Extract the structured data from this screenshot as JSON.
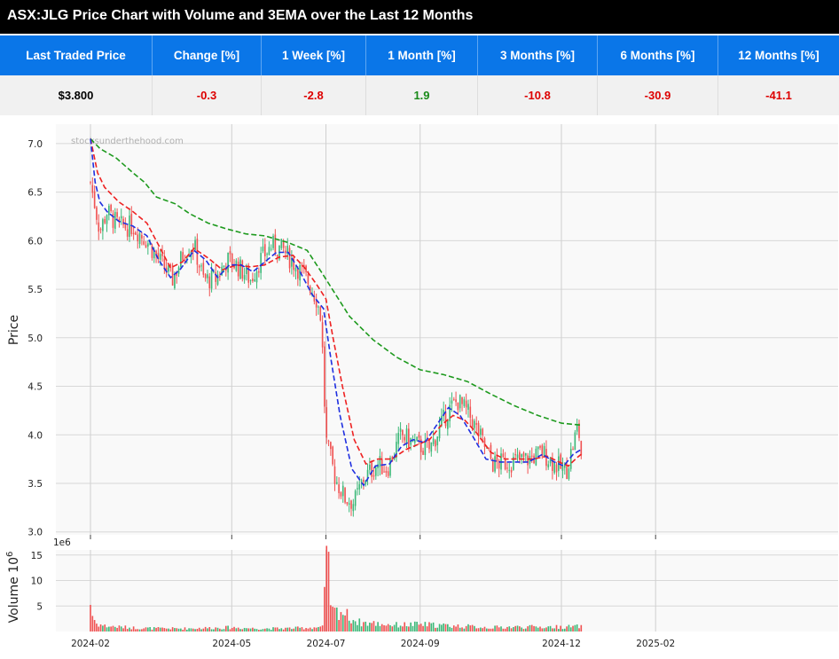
{
  "title": "ASX:JLG Price Chart with Volume and 3EMA over the Last 12 Months",
  "table": {
    "headers": [
      "Last Traded Price",
      "Change [%]",
      "1 Week [%]",
      "1 Month [%]",
      "3 Months [%]",
      "6 Months [%]",
      "12 Months [%]"
    ],
    "values": [
      {
        "text": "$3.800",
        "tone": "neutral"
      },
      {
        "text": "-0.3",
        "tone": "neg"
      },
      {
        "text": "-2.8",
        "tone": "neg"
      },
      {
        "text": "1.9",
        "tone": "pos"
      },
      {
        "text": "-10.8",
        "tone": "neg"
      },
      {
        "text": "-30.9",
        "tone": "neg"
      },
      {
        "text": "-41.1",
        "tone": "neg"
      }
    ]
  },
  "colors": {
    "header_bg": "#0a76e8",
    "up": "#3cb878",
    "down": "#f05252",
    "ema_short": "#1f2fe0",
    "ema_mid": "#ee2222",
    "ema_long": "#1e9a1e"
  },
  "chart_data": {
    "type": "candlestick",
    "watermark": "stocksunderthehood.com",
    "price_axis": {
      "label": "Price",
      "ylim": [
        2.97,
        7.2
      ],
      "ticks": [
        3.0,
        3.5,
        4.0,
        4.5,
        5.0,
        5.5,
        6.0,
        6.5,
        7.0
      ],
      "tick_labels": [
        "3.0",
        "3.5",
        "4.0",
        "4.5",
        "5.0",
        "5.5",
        "6.0",
        "6.5",
        "7.0"
      ]
    },
    "volume_axis": {
      "label": "Volume  10",
      "label_sup": "6",
      "offset_text": "1e6",
      "ylim": [
        0,
        16
      ],
      "ticks": [
        5,
        10,
        15
      ],
      "tick_labels": [
        "5",
        "10",
        "15"
      ]
    },
    "x_axis": {
      "tick_labels": [
        "2024-02",
        "2024-05",
        "2024-07",
        "2024-09",
        "2024-12",
        "2025-02"
      ],
      "tick_months": [
        0,
        3,
        5,
        7,
        10,
        12
      ]
    },
    "grid": true,
    "close_keypoints": [
      [
        0,
        6.6
      ],
      [
        0.12,
        6.3
      ],
      [
        0.2,
        6.1
      ],
      [
        0.35,
        6.3
      ],
      [
        0.6,
        6.15
      ],
      [
        0.9,
        6.15
      ],
      [
        1.2,
        6.0
      ],
      [
        1.45,
        5.8
      ],
      [
        1.75,
        5.6
      ],
      [
        2.0,
        5.9
      ],
      [
        2.2,
        5.95
      ],
      [
        2.4,
        5.6
      ],
      [
        2.65,
        5.6
      ],
      [
        2.9,
        5.8
      ],
      [
        3.1,
        5.75
      ],
      [
        3.4,
        5.6
      ],
      [
        3.6,
        5.8
      ],
      [
        3.85,
        5.95
      ],
      [
        4.1,
        5.9
      ],
      [
        4.35,
        5.75
      ],
      [
        4.6,
        5.6
      ],
      [
        4.8,
        5.4
      ],
      [
        4.9,
        5.2
      ],
      [
        5.0,
        3.95
      ],
      [
        5.2,
        3.55
      ],
      [
        5.4,
        3.35
      ],
      [
        5.6,
        3.3
      ],
      [
        5.8,
        3.55
      ],
      [
        6.1,
        3.7
      ],
      [
        6.3,
        3.65
      ],
      [
        6.6,
        4.0
      ],
      [
        6.9,
        3.9
      ],
      [
        7.2,
        3.85
      ],
      [
        7.6,
        4.25
      ],
      [
        7.8,
        4.35
      ],
      [
        8.05,
        4.2
      ],
      [
        8.3,
        3.95
      ],
      [
        8.55,
        3.7
      ],
      [
        8.9,
        3.72
      ],
      [
        9.3,
        3.75
      ],
      [
        9.6,
        3.82
      ],
      [
        9.85,
        3.7
      ],
      [
        10.1,
        3.62
      ],
      [
        10.25,
        3.9
      ],
      [
        10.35,
        4.1
      ],
      [
        10.4,
        3.9
      ],
      [
        10.42,
        3.8
      ]
    ],
    "ema_short_keypoints": [
      [
        0,
        7.05
      ],
      [
        0.1,
        6.6
      ],
      [
        0.2,
        6.4
      ],
      [
        0.35,
        6.3
      ],
      [
        0.6,
        6.2
      ],
      [
        0.9,
        6.15
      ],
      [
        1.2,
        6.05
      ],
      [
        1.45,
        5.8
      ],
      [
        1.7,
        5.62
      ],
      [
        1.9,
        5.7
      ],
      [
        2.2,
        5.9
      ],
      [
        2.45,
        5.8
      ],
      [
        2.7,
        5.62
      ],
      [
        2.95,
        5.75
      ],
      [
        3.2,
        5.75
      ],
      [
        3.45,
        5.68
      ],
      [
        3.7,
        5.78
      ],
      [
        3.95,
        5.88
      ],
      [
        4.2,
        5.88
      ],
      [
        4.45,
        5.68
      ],
      [
        4.7,
        5.45
      ],
      [
        4.95,
        5.3
      ],
      [
        5.1,
        4.8
      ],
      [
        5.3,
        4.2
      ],
      [
        5.55,
        3.65
      ],
      [
        5.8,
        3.48
      ],
      [
        6.05,
        3.68
      ],
      [
        6.35,
        3.7
      ],
      [
        6.6,
        3.88
      ],
      [
        6.85,
        3.95
      ],
      [
        7.1,
        3.92
      ],
      [
        7.35,
        4.1
      ],
      [
        7.6,
        4.28
      ],
      [
        7.85,
        4.2
      ],
      [
        8.1,
        4.0
      ],
      [
        8.4,
        3.75
      ],
      [
        8.7,
        3.72
      ],
      [
        9.0,
        3.72
      ],
      [
        9.3,
        3.72
      ],
      [
        9.6,
        3.8
      ],
      [
        9.85,
        3.72
      ],
      [
        10.05,
        3.68
      ],
      [
        10.25,
        3.8
      ],
      [
        10.42,
        3.85
      ]
    ],
    "ema_mid_keypoints": [
      [
        0,
        7.05
      ],
      [
        0.15,
        6.7
      ],
      [
        0.3,
        6.55
      ],
      [
        0.6,
        6.4
      ],
      [
        0.9,
        6.3
      ],
      [
        1.2,
        6.18
      ],
      [
        1.45,
        5.95
      ],
      [
        1.7,
        5.72
      ],
      [
        1.95,
        5.78
      ],
      [
        2.2,
        5.92
      ],
      [
        2.5,
        5.82
      ],
      [
        2.8,
        5.7
      ],
      [
        3.1,
        5.75
      ],
      [
        3.4,
        5.73
      ],
      [
        3.7,
        5.75
      ],
      [
        4.0,
        5.83
      ],
      [
        4.3,
        5.85
      ],
      [
        4.55,
        5.72
      ],
      [
        4.8,
        5.55
      ],
      [
        5.0,
        5.4
      ],
      [
        5.15,
        5.0
      ],
      [
        5.35,
        4.5
      ],
      [
        5.6,
        3.95
      ],
      [
        5.85,
        3.7
      ],
      [
        6.1,
        3.75
      ],
      [
        6.4,
        3.75
      ],
      [
        6.7,
        3.85
      ],
      [
        6.95,
        3.9
      ],
      [
        7.2,
        3.95
      ],
      [
        7.45,
        4.1
      ],
      [
        7.7,
        4.2
      ],
      [
        7.95,
        4.15
      ],
      [
        8.2,
        4.02
      ],
      [
        8.5,
        3.82
      ],
      [
        8.8,
        3.75
      ],
      [
        9.1,
        3.75
      ],
      [
        9.4,
        3.75
      ],
      [
        9.7,
        3.78
      ],
      [
        9.95,
        3.72
      ],
      [
        10.15,
        3.68
      ],
      [
        10.32,
        3.76
      ],
      [
        10.42,
        3.8
      ]
    ],
    "ema_long_keypoints": [
      [
        0,
        7.05
      ],
      [
        0.2,
        6.95
      ],
      [
        0.55,
        6.85
      ],
      [
        0.9,
        6.7
      ],
      [
        1.15,
        6.6
      ],
      [
        1.4,
        6.45
      ],
      [
        1.8,
        6.38
      ],
      [
        2.1,
        6.28
      ],
      [
        2.5,
        6.18
      ],
      [
        2.9,
        6.12
      ],
      [
        3.3,
        6.07
      ],
      [
        3.7,
        6.05
      ],
      [
        4.2,
        5.98
      ],
      [
        4.6,
        5.9
      ],
      [
        4.9,
        5.68
      ],
      [
        5.2,
        5.45
      ],
      [
        5.5,
        5.22
      ],
      [
        6.0,
        4.98
      ],
      [
        6.5,
        4.8
      ],
      [
        7.0,
        4.67
      ],
      [
        7.5,
        4.62
      ],
      [
        8.0,
        4.55
      ],
      [
        8.5,
        4.42
      ],
      [
        9.0,
        4.3
      ],
      [
        9.5,
        4.2
      ],
      [
        10.0,
        4.12
      ],
      [
        10.42,
        4.1
      ]
    ],
    "volume_keypoints": [
      [
        0,
        5.5
      ],
      [
        0.05,
        3.0
      ],
      [
        0.12,
        1.6
      ],
      [
        0.3,
        1.1
      ],
      [
        0.6,
        0.9
      ],
      [
        1.0,
        0.7
      ],
      [
        1.5,
        0.6
      ],
      [
        2.0,
        0.6
      ],
      [
        2.5,
        0.7
      ],
      [
        3.0,
        0.8
      ],
      [
        3.5,
        0.6
      ],
      [
        4.0,
        0.6
      ],
      [
        4.5,
        0.7
      ],
      [
        4.95,
        0.9
      ],
      [
        5.0,
        14.5
      ],
      [
        5.03,
        13.8
      ],
      [
        5.1,
        6.5
      ],
      [
        5.15,
        3.5
      ],
      [
        5.3,
        4.2
      ],
      [
        5.5,
        2.8
      ],
      [
        5.7,
        1.8
      ],
      [
        6.0,
        1.6
      ],
      [
        6.5,
        1.3
      ],
      [
        7.0,
        1.4
      ],
      [
        7.5,
        1.2
      ],
      [
        8.0,
        1.0
      ],
      [
        8.5,
        0.8
      ],
      [
        9.0,
        0.9
      ],
      [
        9.5,
        0.9
      ],
      [
        10.0,
        0.9
      ],
      [
        10.42,
        1.0
      ]
    ]
  }
}
